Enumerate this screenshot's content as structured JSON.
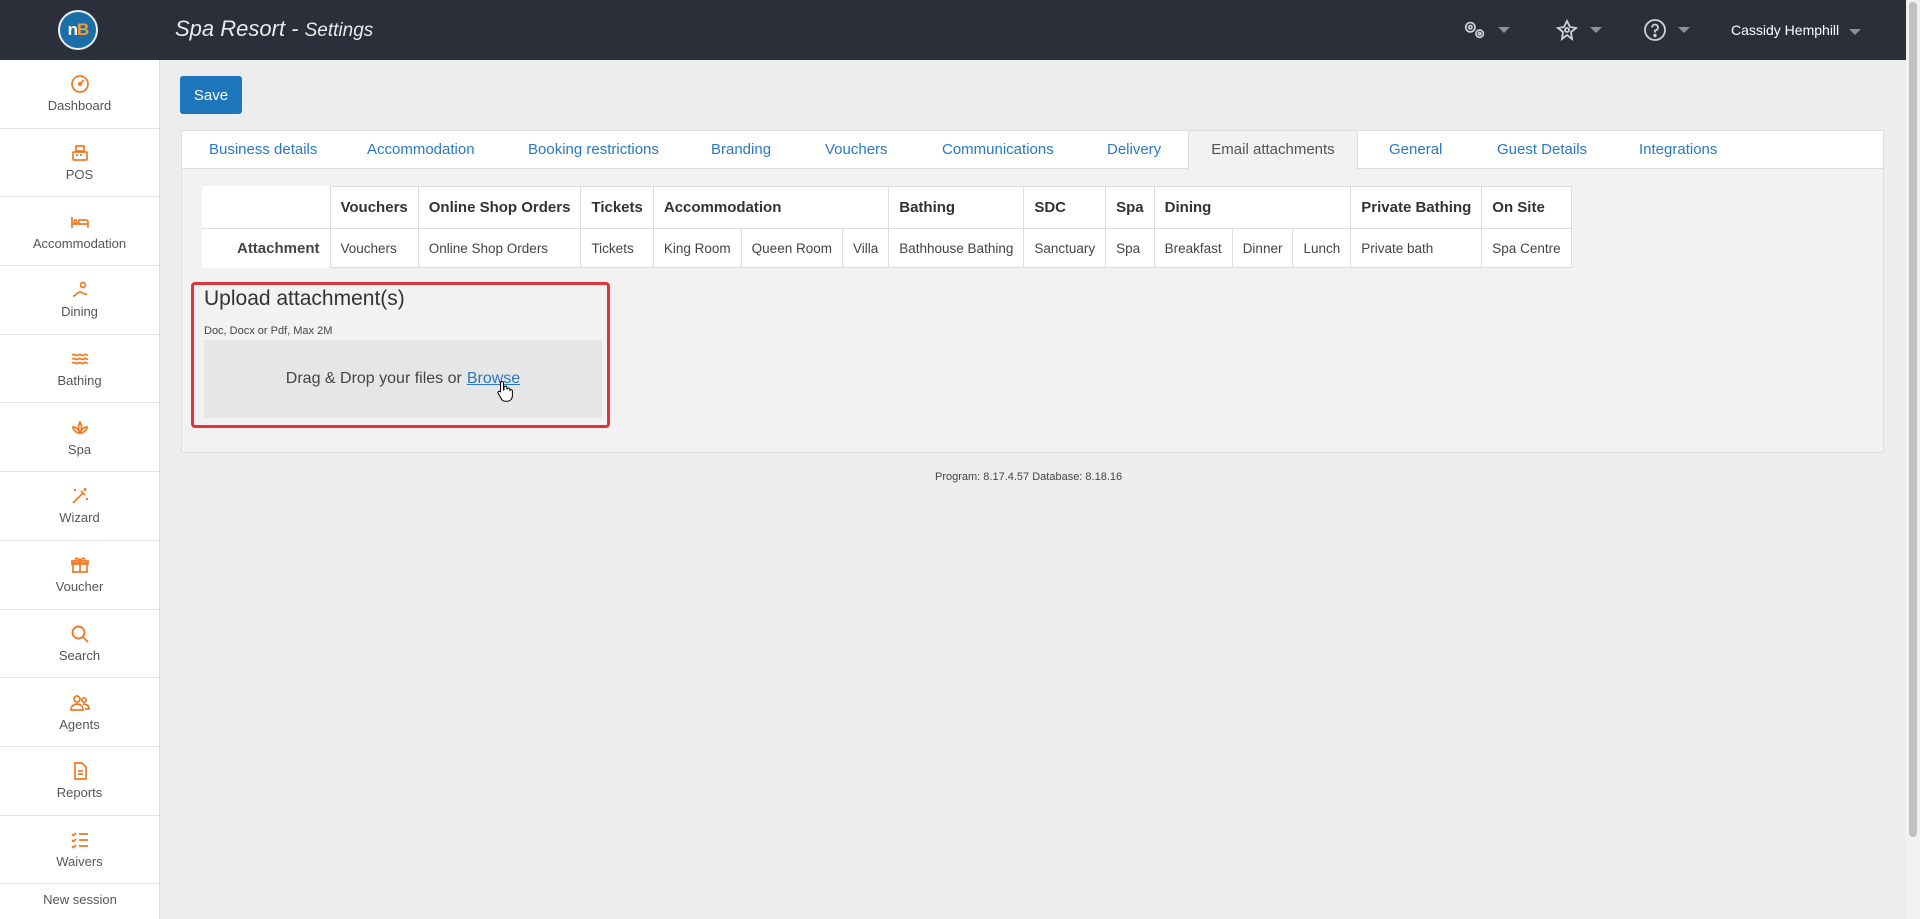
{
  "app": {
    "title": "Spa Resort",
    "separator": " - ",
    "page": "Settings",
    "logo_n": "n",
    "logo_b": "B"
  },
  "header": {
    "user_name": "Cassidy Hemphill",
    "icons": [
      "gears-icon",
      "flower-icon",
      "help-icon"
    ]
  },
  "sidebar": {
    "items": [
      {
        "label": "Dashboard",
        "icon": "gauge-icon"
      },
      {
        "label": "POS",
        "icon": "register-icon"
      },
      {
        "label": "Accommodation",
        "icon": "bed-icon"
      },
      {
        "label": "Dining",
        "icon": "dining-icon"
      },
      {
        "label": "Bathing",
        "icon": "waves-icon"
      },
      {
        "label": "Spa",
        "icon": "lotus-icon"
      },
      {
        "label": "Wizard",
        "icon": "wand-icon"
      },
      {
        "label": "Voucher",
        "icon": "gift-icon"
      },
      {
        "label": "Search",
        "icon": "search-icon"
      },
      {
        "label": "Agents",
        "icon": "agents-icon"
      },
      {
        "label": "Reports",
        "icon": "report-icon"
      },
      {
        "label": "Waivers",
        "icon": "checklist-icon"
      }
    ],
    "bottom_label": "New session"
  },
  "toolbar": {
    "save_label": "Save"
  },
  "tabs": [
    {
      "label": "Business details"
    },
    {
      "label": "Accommodation"
    },
    {
      "label": "Booking restrictions"
    },
    {
      "label": "Branding"
    },
    {
      "label": "Vouchers"
    },
    {
      "label": "Communications"
    },
    {
      "label": "Delivery"
    },
    {
      "label": "Email attachments",
      "active": true
    },
    {
      "label": "General"
    },
    {
      "label": "Guest Details"
    },
    {
      "label": "Integrations"
    }
  ],
  "grid": {
    "row_header": "Attachment",
    "groups": [
      {
        "label": "Vouchers",
        "items": [
          "Vouchers"
        ]
      },
      {
        "label": "Online Shop Orders",
        "items": [
          "Online Shop Orders"
        ]
      },
      {
        "label": "Tickets",
        "items": [
          "Tickets"
        ]
      },
      {
        "label": "Accommodation",
        "items": [
          "King Room",
          "Queen Room",
          "Villa"
        ]
      },
      {
        "label": "Bathing",
        "items": [
          "Bathhouse Bathing"
        ]
      },
      {
        "label": "SDC",
        "items": [
          "Sanctuary"
        ]
      },
      {
        "label": "Spa",
        "items": [
          "Spa"
        ]
      },
      {
        "label": "Dining",
        "items": [
          "Breakfast",
          "Dinner",
          "Lunch"
        ]
      },
      {
        "label": "Private Bathing",
        "items": [
          "Private bath"
        ]
      },
      {
        "label": "On Site",
        "items": [
          "Spa Centre"
        ]
      }
    ]
  },
  "upload": {
    "title": "Upload attachment(s)",
    "hint": "Doc, Docx or Pdf, Max 2M",
    "drop_text": "Drag & Drop your files or",
    "browse_label": "Browse"
  },
  "footer": {
    "version": "Program: 8.17.4.57 Database: 8.18.16"
  },
  "colors": {
    "topbar": "#2b2f3a",
    "accent": "#1d75bc",
    "icon": "#f07a22",
    "highlight": "#e0353f"
  }
}
